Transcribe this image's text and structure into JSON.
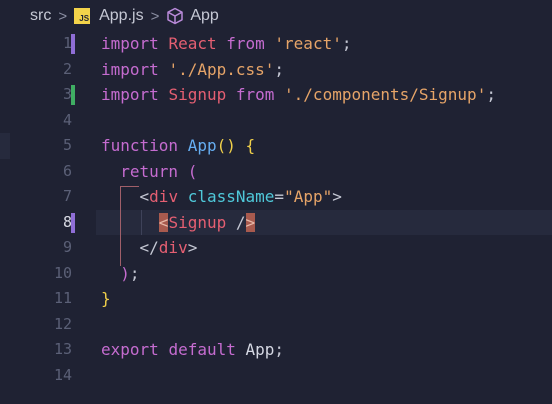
{
  "breadcrumb": {
    "folder": "src",
    "file_icon_text": "JS",
    "file": "App.js",
    "symbol": "App"
  },
  "editor": {
    "active_line": 8,
    "lines": [
      {
        "num": "1",
        "mark": "#8f6ed6",
        "tokens": [
          [
            "kw",
            "import "
          ],
          [
            "def",
            "React"
          ],
          [
            "kw",
            " from "
          ],
          [
            "str",
            "'react'"
          ],
          [
            "punc",
            ";"
          ]
        ]
      },
      {
        "num": "2",
        "mark": "",
        "tokens": [
          [
            "kw",
            "import "
          ],
          [
            "str",
            "'./App.css'"
          ],
          [
            "punc",
            ";"
          ]
        ]
      },
      {
        "num": "3",
        "mark": "#3fae63",
        "tokens": [
          [
            "kw",
            "import "
          ],
          [
            "def",
            "Signup"
          ],
          [
            "kw",
            " from "
          ],
          [
            "str",
            "'./components/Signup'"
          ],
          [
            "punc",
            ";"
          ]
        ]
      },
      {
        "num": "4",
        "mark": "",
        "tokens": []
      },
      {
        "num": "5",
        "mark": "",
        "tokens": [
          [
            "kw",
            "function "
          ],
          [
            "fn",
            "App"
          ],
          [
            "brace",
            "()"
          ],
          [
            "plain",
            " "
          ],
          [
            "brace",
            "{"
          ]
        ]
      },
      {
        "num": "6",
        "mark": "",
        "tokens": [
          [
            "plain",
            "  "
          ],
          [
            "kw",
            "return "
          ],
          [
            "paren",
            "("
          ]
        ]
      },
      {
        "num": "7",
        "mark": "",
        "tokens": [
          [
            "plain",
            "    "
          ],
          [
            "punc",
            "<"
          ],
          [
            "tag",
            "div"
          ],
          [
            "plain",
            " "
          ],
          [
            "attr",
            "className"
          ],
          [
            "punc",
            "="
          ],
          [
            "str",
            "\"App\""
          ],
          [
            "punc",
            ">"
          ]
        ]
      },
      {
        "num": "8",
        "mark": "#8f6ed6",
        "tokens": [
          [
            "plain",
            "      "
          ],
          [
            "match-bracket",
            "<"
          ],
          [
            "tag",
            "Signup"
          ],
          [
            "plain",
            " "
          ],
          [
            "punc",
            "/"
          ],
          [
            "match-bracket",
            ">"
          ]
        ]
      },
      {
        "num": "9",
        "mark": "",
        "tokens": [
          [
            "plain",
            "    "
          ],
          [
            "punc",
            "</"
          ],
          [
            "tag",
            "div"
          ],
          [
            "punc",
            ">"
          ]
        ]
      },
      {
        "num": "10",
        "mark": "",
        "tokens": [
          [
            "plain",
            "  "
          ],
          [
            "paren",
            ")"
          ],
          [
            "punc",
            ";"
          ]
        ]
      },
      {
        "num": "11",
        "mark": "",
        "tokens": [
          [
            "brace",
            "}"
          ]
        ]
      },
      {
        "num": "12",
        "mark": "",
        "tokens": []
      },
      {
        "num": "13",
        "mark": "",
        "tokens": [
          [
            "kw",
            "export "
          ],
          [
            "kw",
            "default "
          ],
          [
            "plain",
            "App"
          ],
          [
            "punc",
            ";"
          ]
        ]
      },
      {
        "num": "14",
        "mark": "",
        "tokens": []
      }
    ]
  }
}
